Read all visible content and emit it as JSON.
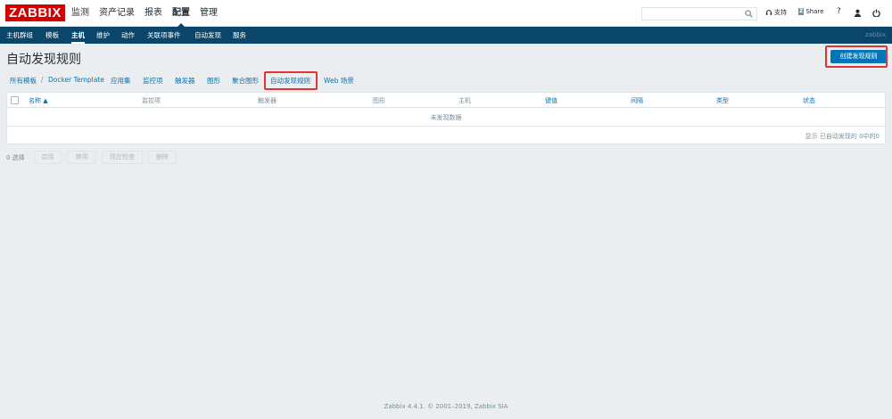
{
  "header": {
    "logo": "ZABBIX",
    "menu": [
      "监测",
      "资产记录",
      "报表",
      "配置",
      "管理"
    ],
    "active_menu_index": 3,
    "search_value": "",
    "support_label": "支持",
    "share_badge": "Z",
    "share_label": "Share",
    "help_label": "?"
  },
  "subnav": {
    "items": [
      "主机群组",
      "模板",
      "主机",
      "维护",
      "动作",
      "关联项事件",
      "自动发现",
      "服务"
    ],
    "active_index": 2,
    "server_name": "zabbix"
  },
  "page": {
    "title": "自动发现规则",
    "create_button": "创建发现规则"
  },
  "breadcrumb": {
    "all_templates": "所有模板",
    "separator": "/",
    "template": "Docker Template",
    "tabs": [
      "应用集",
      "监控项",
      "触发器",
      "图形",
      "聚合图形",
      "自动发现规则",
      "Web 场景"
    ],
    "active_tab_index": 5
  },
  "table": {
    "columns": {
      "name": "名称 ▲",
      "items": "监控项",
      "triggers": "触发器",
      "graphs": "图形",
      "hosts": "主机",
      "key": "键值",
      "interval": "间隔",
      "type": "类型",
      "status": "状态"
    },
    "empty_text": "未发现数据",
    "paging_text": "显示 已自动发现的 0中的0"
  },
  "actions": {
    "selected_count": "0 选择",
    "enable": "启用",
    "disable": "禁用",
    "check_now": "现在检查",
    "delete": "删除"
  },
  "footer": "Zabbix 4.4.1. © 2001–2019, Zabbix SIA",
  "colors": {
    "brand_red": "#d40000",
    "nav_blue": "#0a466a",
    "link_blue": "#0275b8",
    "highlight_red": "#e33434"
  }
}
